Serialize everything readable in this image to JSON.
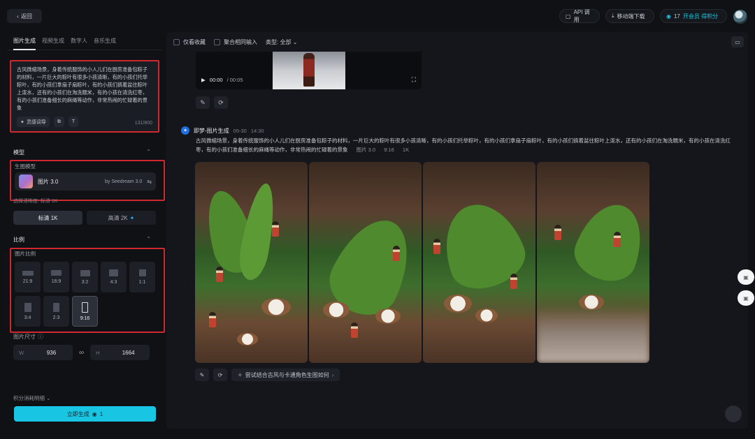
{
  "topbar": {
    "back_label": "返回",
    "api_label": "API 调用",
    "download_label": "移动端下载",
    "vip_count": "17",
    "vip_label": "开会员 得积分"
  },
  "left": {
    "tabs": [
      "图片生成",
      "视频生成",
      "数字人",
      "音乐生成"
    ],
    "prompt_text": "古风微缩场景，身着传统服饰的小人儿们在厨房准备包粽子的材料，一片巨大的粽叶有很多小孩清晰，有的小孩们托举粽叶，有的小孩们拿扇子扇粽叶，有的小孩们搞着盆往粽叶上泼水，还有的小孩们在淘洗糯米，有的小孩在清洗红枣，有的小孩们准备细长的麻绳等动作，非常热闹的忙碌着的景象",
    "tool_inspire": "灵感词导",
    "counter": "131/800",
    "model_section": "模型",
    "model_label": "生图模型",
    "model_name": "图片 3.0",
    "model_by": "by Seedream 3.0",
    "model_sub": "选择清晰度: 标清 1K",
    "res_options": [
      "标清 1K",
      "高清 2K"
    ],
    "ratio_section": "比例",
    "ratio_label": "图片比例",
    "ratios": [
      "21:9",
      "16:9",
      "3:2",
      "4:3",
      "1:1",
      "3:4",
      "2:3",
      "9:16"
    ],
    "size_label": "图片尺寸",
    "width_key": "W",
    "width_value": "936",
    "height_key": "H",
    "height_value": "1664",
    "points_label": "积分消耗明细",
    "generate_label": "立即生成",
    "generate_cost": "1"
  },
  "main": {
    "filter_favorites": "仅看收藏",
    "filter_aggregate": "聚合相同输入",
    "filter_type": "类型: 全部",
    "video_time": "00:00",
    "video_total": "/ 00:05",
    "entry_title": "即梦-图片生成",
    "entry_date": "05-30",
    "entry_time": "14:30",
    "entry_prompt": "古风微缩场景，身着传统服饰的小人儿们在厨房准备包粽子的材料，一片巨大的粽叶有很多小孩清晰，有的小孩们托举粽叶，有的小孩们拿扇子扇粽叶，有的小孩们搞着盆往粽叶上泼水，还有的小孩们在淘洗糯米，有的小孩在清洗红枣，有的小孩们准备细长的麻绳等动作，非常热闹的忙碌着的景象",
    "entry_model": "图片 3.0",
    "entry_ratio": "9:16",
    "entry_res": "1K",
    "suggest_label": "尝试结合古风与卡通角色生图如何"
  },
  "colors": {
    "accent": "#18c6e3",
    "highlight_border": "#d0282e"
  }
}
